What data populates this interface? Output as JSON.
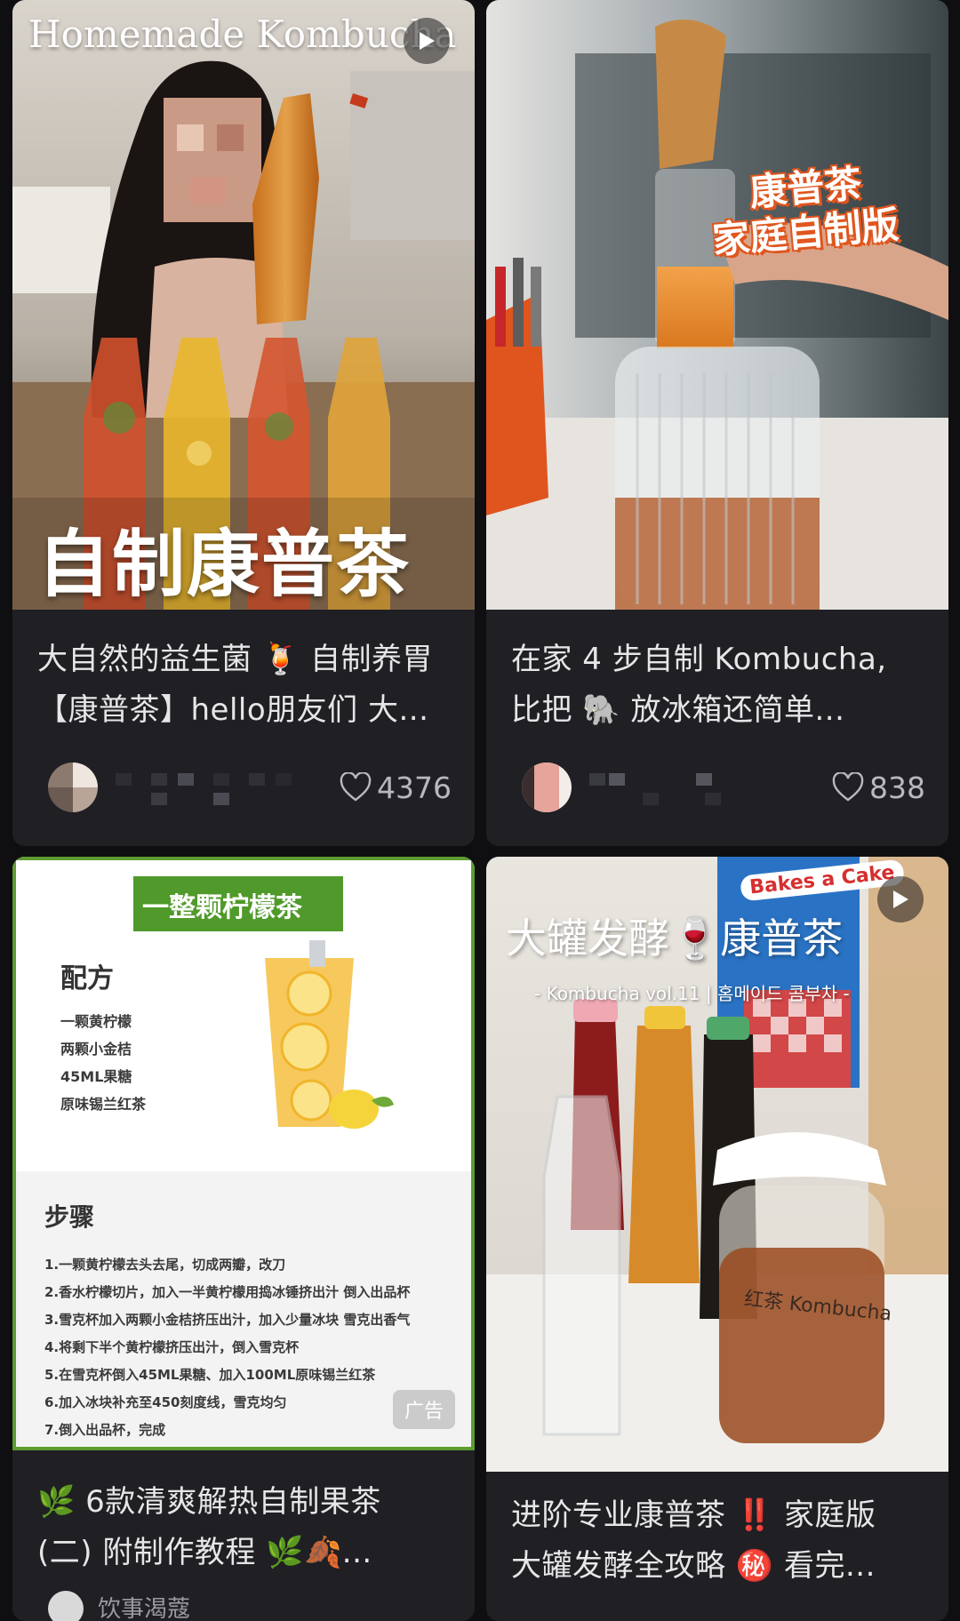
{
  "posts": [
    {
      "cover_overlay_top": "Homemade Kombucha",
      "cover_overlay_bottom": "自制康普茶",
      "has_video": true,
      "title_line1": "大自然的益生菌 🍹 自制养胃",
      "title_line2": "【康普茶】hello朋友们 大...",
      "likes": "4376",
      "icons": [
        "play-icon",
        "heart-icon"
      ]
    },
    {
      "cover_overlay_line1": "康普茶",
      "cover_overlay_line2": "家庭自制版",
      "title_line1": "在家 4 步自制 Kombucha,",
      "title_line2": "比把 🐘 放冰箱还简单...",
      "likes": "838",
      "icons": [
        "heart-icon"
      ]
    },
    {
      "recipe_banner": "一整颗柠檬茶",
      "recipe_heading": "配方",
      "ingredients": [
        "一颗黄柠檬",
        "两颗小金桔",
        "45ML果糖",
        "原味锡兰红茶"
      ],
      "steps_heading": "步骤",
      "steps": [
        "1.一颗黄柠檬去头去尾，切成两瓣，改刀",
        "2.香水柠檬切片，加入一半黄柠檬用捣冰锤挤出汁 倒入出品杯",
        "3.雪克杯加入两颗小金桔挤压出汁，加入少量冰块 雪克出香气",
        "4.将剩下半个黄柠檬挤压出汁，倒入雪克杯",
        "5.在雪克杯倒入45ML果糖、加入100ML原味锡兰红茶",
        "6.加入冰块补充至450刻度线，雪克均匀",
        "7.倒入出品杯，完成"
      ],
      "ad_label": "广告",
      "title_line1": "🌿 6款清爽解热自制果茶",
      "title_line2": "(二) 附制作教程 🌿🍂...",
      "author_partial": "饮事渴蔻",
      "icons": [
        "leaf-icon"
      ]
    },
    {
      "cover_overlay_title": "大罐发酵🍷康普茶",
      "cover_overlay_sub": "- Kombucha vol.11 | 홈메이드 콤부차 -",
      "shop_sign": "Bakes a Cake",
      "jar_label": "红茶 Kombucha",
      "has_video": true,
      "title_line1": "进阶专业康普茶 ‼️ 家庭版",
      "title_line2": "大罐发酵全攻略 ㊙️ 看完...",
      "icons": [
        "play-icon"
      ]
    }
  ],
  "colors": {
    "background": "#0f0f11",
    "card": "#1f1f24",
    "text": "#e6e6e8",
    "meta_text": "#b9b9bd",
    "recipe_green": "#4f9a2a"
  }
}
